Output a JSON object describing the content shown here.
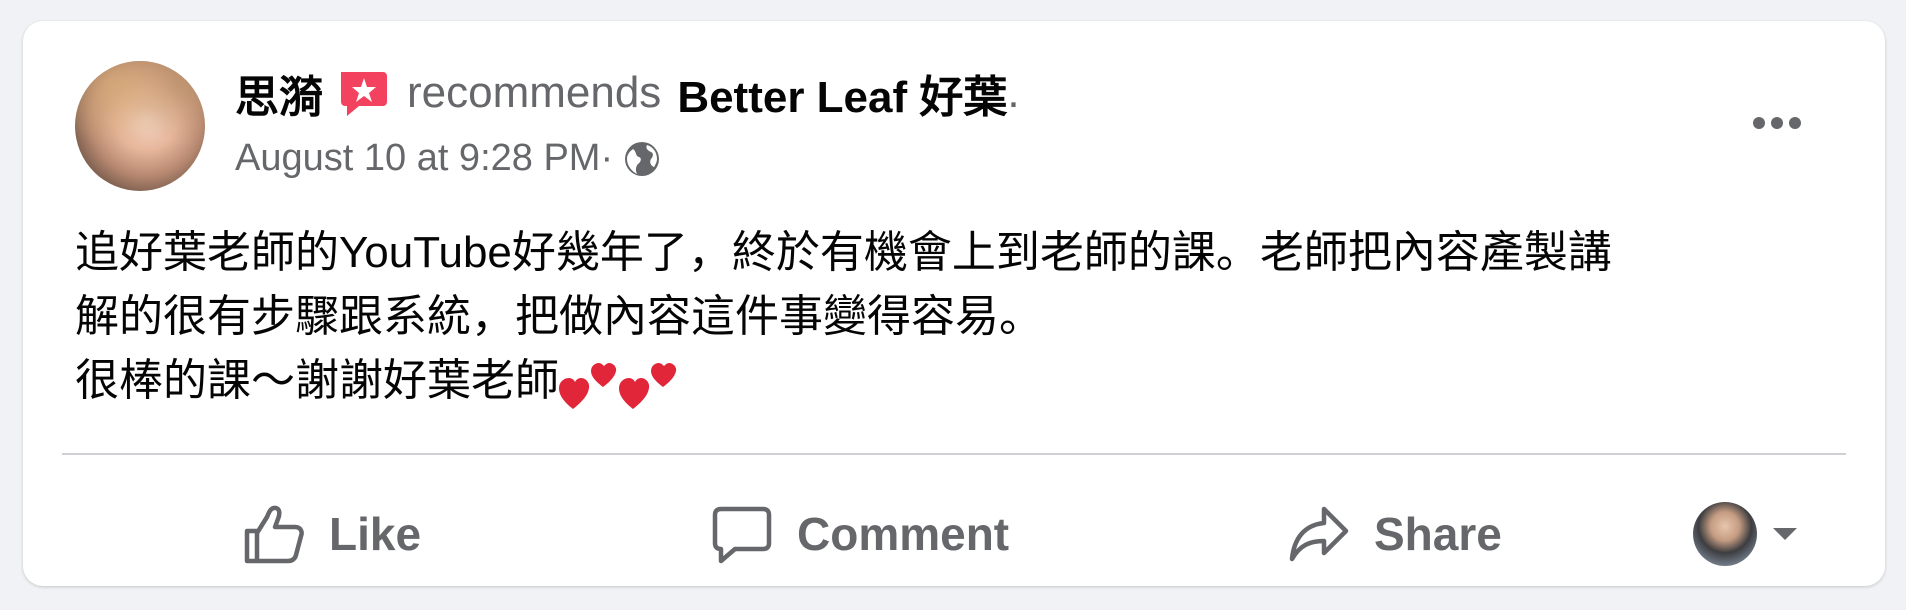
{
  "post": {
    "author": "思漪",
    "verb": "recommends",
    "page_name": "Better Leaf 好葉",
    "page_suffix": ".",
    "timestamp": "August 10 at 9:28 PM",
    "meta_sep": " · ",
    "body_line1": "追好葉老師的YouTube好幾年了，終於有機會上到老師的課。老師把內容產製講",
    "body_line2": "解的很有步驟跟系統，把做內容這件事變得容易。",
    "body_line3": "很棒的課～謝謝好葉老師"
  },
  "actions": {
    "like": "Like",
    "comment": "Comment",
    "share": "Share"
  },
  "icons": {
    "badge": "recommend-star-icon",
    "globe": "public-globe-icon",
    "more": "more-options-icon",
    "like": "thumbs-up-icon",
    "comment": "speech-bubble-icon",
    "share": "share-arrow-icon",
    "heart": "two-hearts-emoji",
    "caret": "caret-down-icon"
  },
  "colors": {
    "badge": "#f3425f",
    "secondary_text": "#65676b",
    "primary_text": "#050505",
    "heart": "#e2263a"
  }
}
